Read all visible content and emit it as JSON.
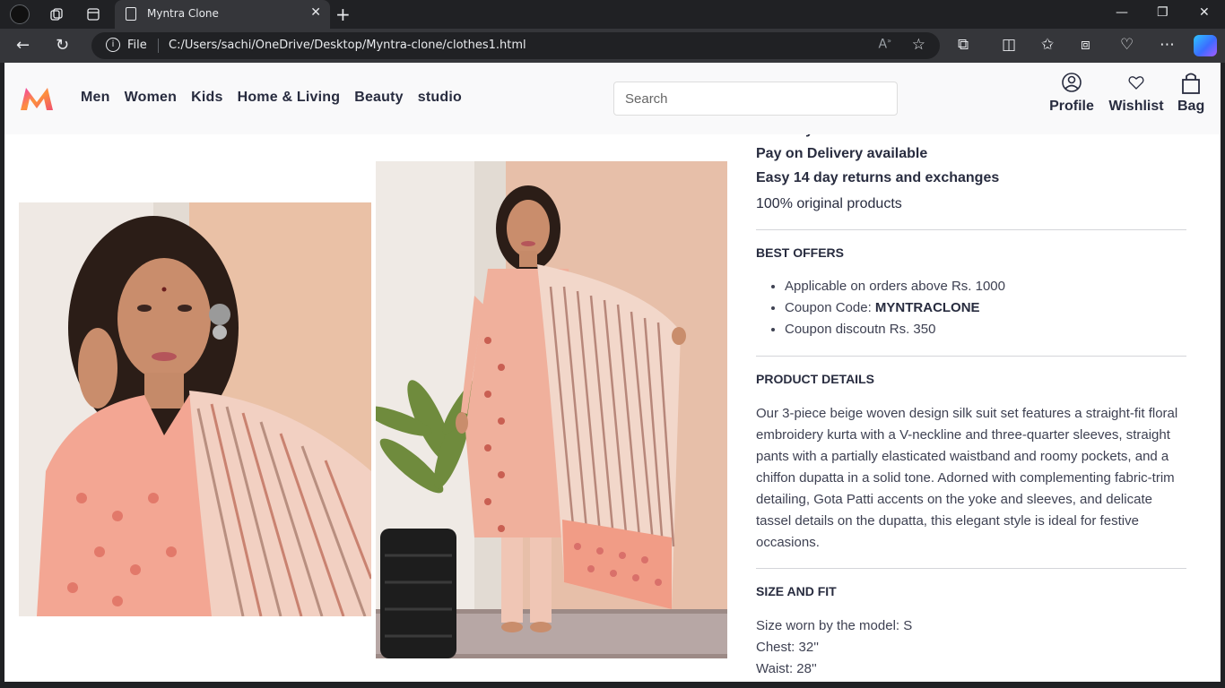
{
  "browser": {
    "tab_title": "Myntra Clone",
    "scheme_label": "File",
    "url": "C:/Users/sachi/OneDrive/Desktop/Myntra-clone/clothes1.html"
  },
  "site": {
    "nav": [
      "Men",
      "Women",
      "Kids",
      "Home & Living",
      "Beauty",
      "studio"
    ],
    "search_placeholder": "Search",
    "actions": {
      "profile": "Profile",
      "wishlist": "Wishlist",
      "bag": "Bag"
    }
  },
  "product": {
    "delivery_cut": "Get it by Tomorrow",
    "pay_on_delivery": "Pay on Delivery available",
    "returns": "Easy 14 day returns and exchanges",
    "original": "100% original products",
    "best_offers": {
      "title": "BEST OFFERS",
      "items": [
        {
          "text": "Applicable on orders above Rs. 1000"
        },
        {
          "text": "Coupon Code: ",
          "bold": "MYNTRACLONE"
        },
        {
          "text": "Coupon discoutn Rs. 350"
        }
      ]
    },
    "product_details": {
      "title": "PRODUCT DETAILS",
      "description": "Our 3-piece beige woven design silk suit set features a straight-fit floral embroidery kurta with a V-neckline and three-quarter sleeves, straight pants with a partially elasticated waistband and roomy pockets, and a chiffon dupatta in a solid tone. Adorned with complementing fabric-trim detailing, Gota Patti accents on the yoke and sleeves, and delicate tassel details on the dupatta, this elegant style is ideal for festive occasions."
    },
    "size_and_fit": {
      "title": "SIZE AND FIT",
      "lines": [
        "Size worn by the model: S",
        "Chest: 32''",
        "Waist: 28''"
      ]
    }
  },
  "colors": {
    "accent": "#ff3f6c",
    "header_bg": "#f9f9fa",
    "text": "#282c3f"
  }
}
